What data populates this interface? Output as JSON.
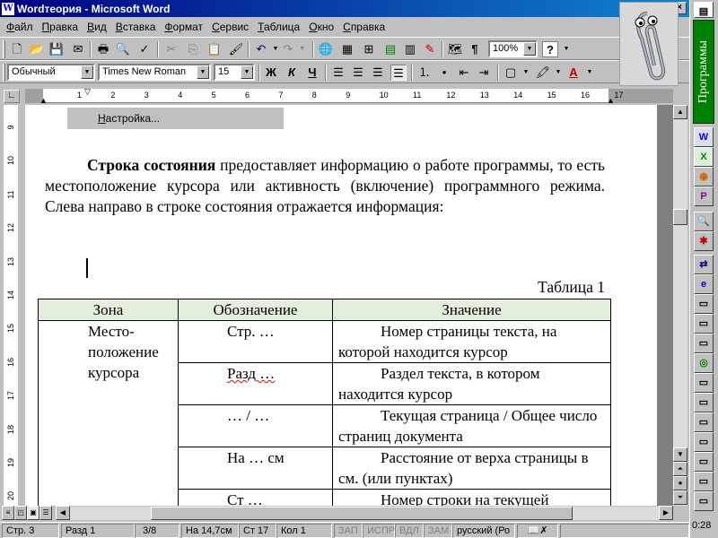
{
  "window": {
    "title": "Wordтеория - Microsoft Word",
    "app_icon": "word-doc-icon",
    "minimize": "_",
    "maximize": "□",
    "close": "×"
  },
  "menu": [
    "Файл",
    "Правка",
    "Вид",
    "Вставка",
    "Формат",
    "Сервис",
    "Таблица",
    "Окно",
    "Справка"
  ],
  "toolbar_standard": {
    "zoom": "100%",
    "help_icon": "?"
  },
  "toolbar_format": {
    "style": "Обычный",
    "font": "Times New Roman",
    "size": "15",
    "bold": "Ж",
    "italic": "К",
    "underline": "Ч"
  },
  "ruler_h": [
    "1",
    "2",
    "3",
    "4",
    "5",
    "6",
    "7",
    "8",
    "9",
    "10",
    "11",
    "12",
    "13",
    "14",
    "15",
    "16",
    "17"
  ],
  "ruler_v": [
    "9",
    "10",
    "11",
    "12",
    "13",
    "14",
    "15",
    "16",
    "17",
    "18",
    "19",
    "20"
  ],
  "menu_fragment": "Настройка...",
  "doc": {
    "para_bold": "Строка состояния",
    "para_rest": " предоставляет информацию о работе программы, то есть местоположение курсора или активность (включение) программного режима. Слева направо в строке состояния отражается информация:",
    "table_caption": "Таблица 1",
    "table": {
      "headers": [
        "Зона",
        "Обозначение",
        "Значение"
      ],
      "zone": "Место-положение курсора",
      "zone_lines": [
        "Место-",
        "положение",
        "курсора"
      ],
      "rows": [
        {
          "code": "Стр. …",
          "meaning": "Номер страницы текста, на которой находится курсор"
        },
        {
          "code": "Разд …",
          "meaning": "Раздел текста, в котором находится курсор"
        },
        {
          "code": "… / …",
          "meaning": "Текущая страница / Общее число страниц документа"
        },
        {
          "code": "На … см",
          "meaning": "Расстояние от верха страницы в см. (или пунктах)"
        },
        {
          "code": "Ст …",
          "meaning": "Номер строки на текущей"
        }
      ]
    }
  },
  "status": {
    "page": "Стр. 3",
    "section": "Разд 1",
    "pages": "3/8",
    "at": "На 14,7см",
    "line": "Ст 17",
    "col": "Кол 1",
    "rec": "ЗАП",
    "trk": "ИСПР",
    "ext": "ВДЛ",
    "ovr": "ЗАМ",
    "lang": "русский (Ро"
  },
  "office_bar": {
    "label": "Программы",
    "clock": "0:28"
  }
}
